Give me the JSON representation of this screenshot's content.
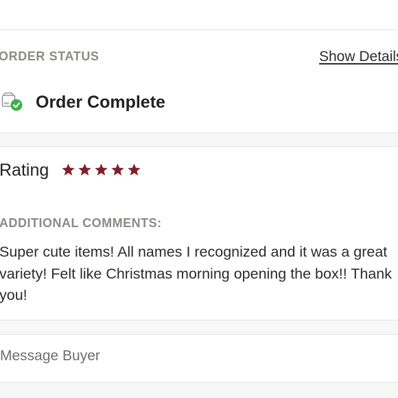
{
  "order_status": {
    "section_label": "ORDER STATUS",
    "show_details_label": "Show Details",
    "status_text": "Order Complete",
    "status_icon": "package-check-icon",
    "status_icon_color": "#3db24a"
  },
  "rating": {
    "label": "Rating",
    "stars_filled": 5,
    "stars_total": 5,
    "star_color": "#7f1f2a"
  },
  "comments": {
    "label": "ADDITIONAL COMMENTS:",
    "text": "Super cute items! All names I recognized and it was a great variety! Felt like Christmas morning opening the box!! Thank you!"
  },
  "message_buyer": {
    "label": "Message Buyer"
  }
}
